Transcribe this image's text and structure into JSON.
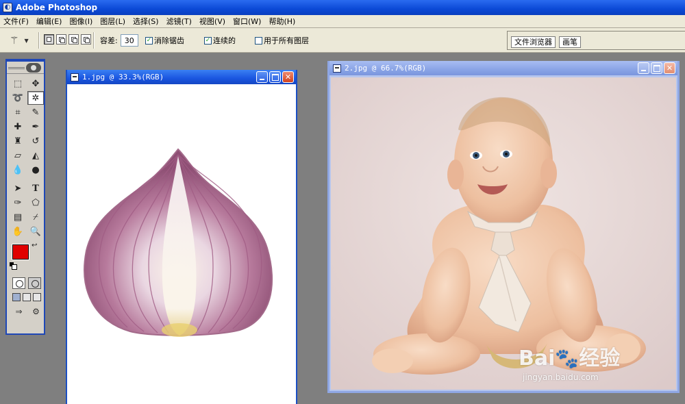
{
  "app": {
    "title": "Adobe Photoshop"
  },
  "menu": [
    "文件(F)",
    "编辑(E)",
    "图像(I)",
    "图层(L)",
    "选择(S)",
    "滤镜(T)",
    "视图(V)",
    "窗口(W)",
    "帮助(H)"
  ],
  "options": {
    "tolerance_label": "容差:",
    "tolerance_value": "30",
    "anti_alias_label": "消除锯齿",
    "anti_alias_checked": true,
    "contiguous_label": "连续的",
    "contiguous_checked": true,
    "all_layers_label": "用于所有图层",
    "all_layers_checked": false
  },
  "panel_tabs": [
    "文件浏览器",
    "画笔"
  ],
  "colors": {
    "foreground": "#e00000",
    "background": "#ffffff"
  },
  "documents": [
    {
      "title": "1.jpg @ 33.3%(RGB)",
      "content": "onion-image",
      "active": true
    },
    {
      "title": "2.jpg @ 66.7%(RGB)",
      "content": "baby-photo",
      "active": false
    }
  ],
  "watermark": {
    "brand_prefix": "Bai",
    "brand_suffix": "经验",
    "url": "jingyan.baidu.com"
  }
}
